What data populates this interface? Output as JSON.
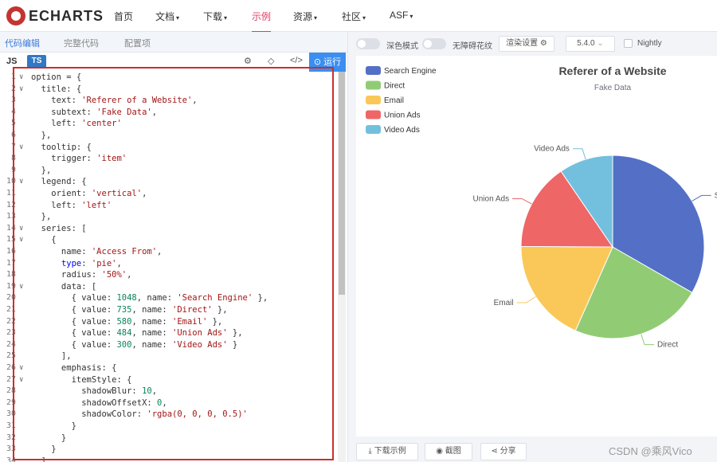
{
  "nav": {
    "logo_text": "ECHARTS",
    "items": [
      {
        "label": "首页",
        "caret": false,
        "active": false
      },
      {
        "label": "文档",
        "caret": true,
        "active": false
      },
      {
        "label": "下载",
        "caret": true,
        "active": false
      },
      {
        "label": "示例",
        "caret": false,
        "active": true
      },
      {
        "label": "资源",
        "caret": true,
        "active": false
      },
      {
        "label": "社区",
        "caret": true,
        "active": false
      },
      {
        "label": "ASF",
        "caret": true,
        "active": false
      }
    ],
    "accent_color": "#e43961"
  },
  "editor_tabs": [
    "代码编辑",
    "完整代码",
    "配置项"
  ],
  "toolbar": {
    "lang_js": "JS",
    "lang_ts": "TS",
    "run_label": "运行",
    "icons": [
      "format-icon",
      "cube-icon",
      "code-icon"
    ]
  },
  "code_lines": [
    {
      "fold": true,
      "html": "option = {"
    },
    {
      "fold": true,
      "html": "  title: {"
    },
    {
      "fold": false,
      "html": "    text: <span class=\"str\">'Referer of a Website'</span>,"
    },
    {
      "fold": false,
      "html": "    subtext: <span class=\"str\">'Fake Data'</span>,"
    },
    {
      "fold": false,
      "html": "    left: <span class=\"str\">'center'</span>"
    },
    {
      "fold": false,
      "html": "  },"
    },
    {
      "fold": true,
      "html": "  tooltip: {"
    },
    {
      "fold": false,
      "html": "    trigger: <span class=\"str\">'item'</span>"
    },
    {
      "fold": false,
      "html": "  },"
    },
    {
      "fold": true,
      "html": "  legend: {"
    },
    {
      "fold": false,
      "html": "    orient: <span class=\"str\">'vertical'</span>,"
    },
    {
      "fold": false,
      "html": "    left: <span class=\"str\">'left'</span>"
    },
    {
      "fold": false,
      "html": "  },"
    },
    {
      "fold": true,
      "html": "  series: ["
    },
    {
      "fold": true,
      "html": "    {"
    },
    {
      "fold": false,
      "html": "      name: <span class=\"str\">'Access From'</span>,"
    },
    {
      "fold": false,
      "html": "      <span class=\"kw\">type</span>: <span class=\"str\">'pie'</span>,"
    },
    {
      "fold": false,
      "html": "      radius: <span class=\"str\">'50%'</span>,"
    },
    {
      "fold": true,
      "html": "      data: ["
    },
    {
      "fold": false,
      "html": "        { value: <span class=\"num\">1048</span>, name: <span class=\"str\">'Search Engine'</span> },"
    },
    {
      "fold": false,
      "html": "        { value: <span class=\"num\">735</span>, name: <span class=\"str\">'Direct'</span> },"
    },
    {
      "fold": false,
      "html": "        { value: <span class=\"num\">580</span>, name: <span class=\"str\">'Email'</span> },"
    },
    {
      "fold": false,
      "html": "        { value: <span class=\"num\">484</span>, name: <span class=\"str\">'Union Ads'</span> },"
    },
    {
      "fold": false,
      "html": "        { value: <span class=\"num\">300</span>, name: <span class=\"str\">'Video Ads'</span> }"
    },
    {
      "fold": false,
      "html": "      ],"
    },
    {
      "fold": true,
      "html": "      emphasis: {"
    },
    {
      "fold": true,
      "html": "        itemStyle: {"
    },
    {
      "fold": false,
      "html": "          shadowBlur: <span class=\"num\">10</span>,"
    },
    {
      "fold": false,
      "html": "          shadowOffsetX: <span class=\"num\">0</span>,"
    },
    {
      "fold": false,
      "html": "          shadowColor: <span class=\"str\">'rgba(0, 0, 0, 0.5)'</span>"
    },
    {
      "fold": false,
      "html": "        }"
    },
    {
      "fold": false,
      "html": "      }"
    },
    {
      "fold": false,
      "html": "    }"
    },
    {
      "fold": false,
      "html": "  ]"
    }
  ],
  "preview_toolbar": {
    "dark_mode_label": "深色模式",
    "a11y_label": "无障碍花纹",
    "render_settings_label": "渲染设置",
    "version": "5.4.0",
    "nightly_label": "Nightly"
  },
  "bottom_buttons": [
    "下载示例",
    "截图",
    "分享"
  ],
  "watermark": "CSDN @乘风Vico",
  "chart_data": {
    "type": "pie",
    "title": "Referer of a Website",
    "subtitle": "Fake Data",
    "legend_position": "top-left",
    "legend_orient": "vertical",
    "slices": [
      {
        "name": "Search Engine",
        "value": 1048,
        "color": "#5470c6",
        "label": "S"
      },
      {
        "name": "Direct",
        "value": 735,
        "color": "#91cc75",
        "label": "Direct"
      },
      {
        "name": "Email",
        "value": 580,
        "color": "#fac858",
        "label": "Email"
      },
      {
        "name": "Union Ads",
        "value": 484,
        "color": "#ee6666",
        "label": "Union Ads"
      },
      {
        "name": "Video Ads",
        "value": 300,
        "color": "#73c0de",
        "label": "Video Ads"
      }
    ]
  }
}
